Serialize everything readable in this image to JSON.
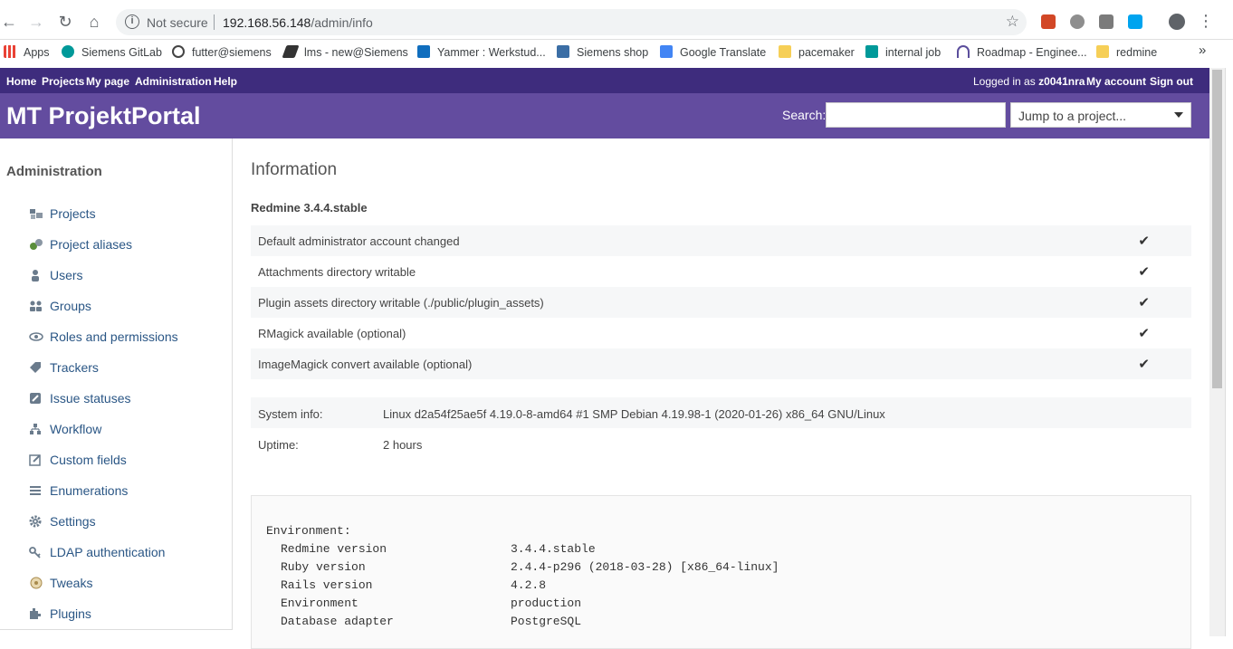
{
  "browser": {
    "security_label": "Not secure",
    "url_host": "192.168.56.148",
    "url_path": "/admin/info",
    "info_icon": "info-icon",
    "bookmarks": [
      {
        "label": "Apps",
        "icon": "apps-grid-icon",
        "color": "#e94235"
      },
      {
        "label": "Siemens GitLab",
        "icon": "gitlab-icon",
        "color": "#009999"
      },
      {
        "label": "futter@siemens",
        "icon": "globe-icon",
        "color": "#444444"
      },
      {
        "label": "lms - new@Siemens",
        "icon": "runner-icon",
        "color": "#333333"
      },
      {
        "label": "Yammer : Werkstud...",
        "icon": "yammer-icon",
        "color": "#106ebe"
      },
      {
        "label": "Siemens shop",
        "icon": "shop-icon",
        "color": "#3b6ea5"
      },
      {
        "label": "Google Translate",
        "icon": "translate-icon",
        "color": "#4285f4"
      },
      {
        "label": "pacemaker",
        "icon": "folder-icon",
        "color": "#f6cf57"
      },
      {
        "label": "internal job",
        "icon": "s-icon",
        "color": "#009999"
      },
      {
        "label": "Roadmap - Enginee...",
        "icon": "roadmap-icon",
        "color": "#5b4e9c"
      },
      {
        "label": "redmine",
        "icon": "folder-icon",
        "color": "#f6cf57"
      }
    ],
    "more_bookmarks": "»"
  },
  "topbar": {
    "home": "Home",
    "projects": "Projects",
    "my_page": "My page",
    "administration": "Administration",
    "help": "Help",
    "logged_in_prefix": "Logged in as",
    "username": "z0041nra",
    "my_account": "My account",
    "sign_out": "Sign out"
  },
  "header": {
    "title": "MT ProjektPortal",
    "search_label": "Search:",
    "jump_placeholder": "Jump to a project..."
  },
  "sidebar": {
    "title": "Administration",
    "items": [
      {
        "label": "Projects",
        "icon": "projects-icon"
      },
      {
        "label": "Project aliases",
        "icon": "project-aliases-icon"
      },
      {
        "label": "Users",
        "icon": "user-icon"
      },
      {
        "label": "Groups",
        "icon": "group-icon"
      },
      {
        "label": "Roles and permissions",
        "icon": "eye-icon"
      },
      {
        "label": "Trackers",
        "icon": "tag-icon"
      },
      {
        "label": "Issue statuses",
        "icon": "edit-icon"
      },
      {
        "label": "Workflow",
        "icon": "workflow-icon"
      },
      {
        "label": "Custom fields",
        "icon": "custom-field-icon"
      },
      {
        "label": "Enumerations",
        "icon": "list-icon"
      },
      {
        "label": "Settings",
        "icon": "gear-icon"
      },
      {
        "label": "LDAP authentication",
        "icon": "key-icon"
      },
      {
        "label": "Tweaks",
        "icon": "tweaks-icon"
      },
      {
        "label": "Plugins",
        "icon": "plugin-icon"
      }
    ]
  },
  "main": {
    "heading": "Information",
    "version": "Redmine 3.4.4.stable",
    "checks": [
      {
        "label": "Default administrator account changed",
        "ok": "✔"
      },
      {
        "label": "Attachments directory writable",
        "ok": "✔"
      },
      {
        "label": "Plugin assets directory writable (./public/plugin_assets)",
        "ok": "✔"
      },
      {
        "label": "RMagick available (optional)",
        "ok": "✔"
      },
      {
        "label": "ImageMagick convert available (optional)",
        "ok": "✔"
      }
    ],
    "system": [
      {
        "key": "System info:",
        "value": "Linux d2a54f25ae5f 4.19.0-8-amd64 #1 SMP Debian 4.19.98-1 (2020-01-26) x86_64 GNU/Linux"
      },
      {
        "key": "Uptime:",
        "value": "2 hours"
      }
    ],
    "environment_title": "Environment:",
    "environment": [
      {
        "key": "Redmine version",
        "value": "3.4.4.stable"
      },
      {
        "key": "Ruby version",
        "value": "2.4.4-p296 (2018-03-28) [x86_64-linux]"
      },
      {
        "key": "Rails version",
        "value": "4.2.8"
      },
      {
        "key": "Environment",
        "value": "production"
      },
      {
        "key": "Database adapter",
        "value": "PostgreSQL"
      }
    ]
  }
}
